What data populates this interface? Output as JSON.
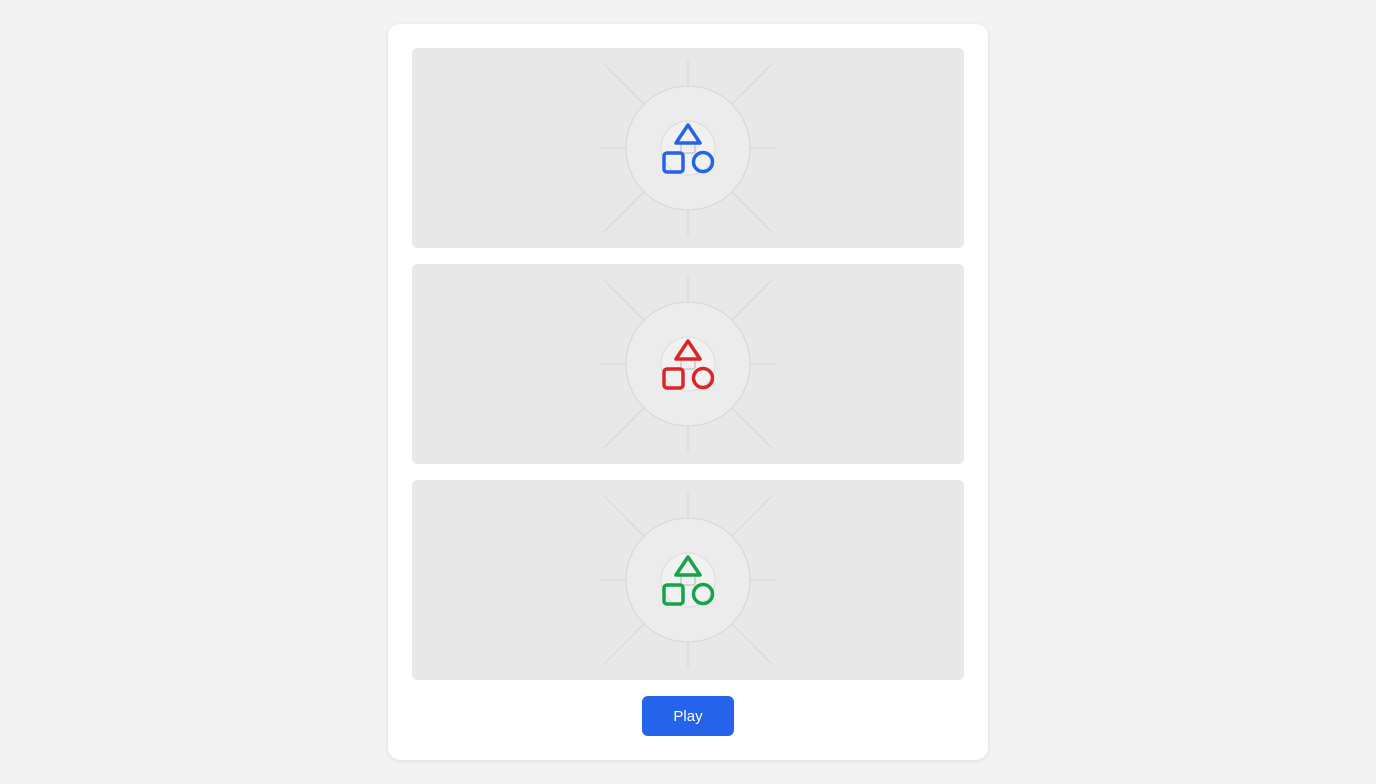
{
  "panels": [
    {
      "name": "blue",
      "color": "#2563eb",
      "icon": "shapes-icon"
    },
    {
      "name": "red",
      "color": "#dc2626",
      "icon": "shapes-icon"
    },
    {
      "name": "green",
      "color": "#16a34a",
      "icon": "shapes-icon"
    }
  ],
  "play_button": {
    "label": "Play",
    "color": "#2563eb"
  }
}
